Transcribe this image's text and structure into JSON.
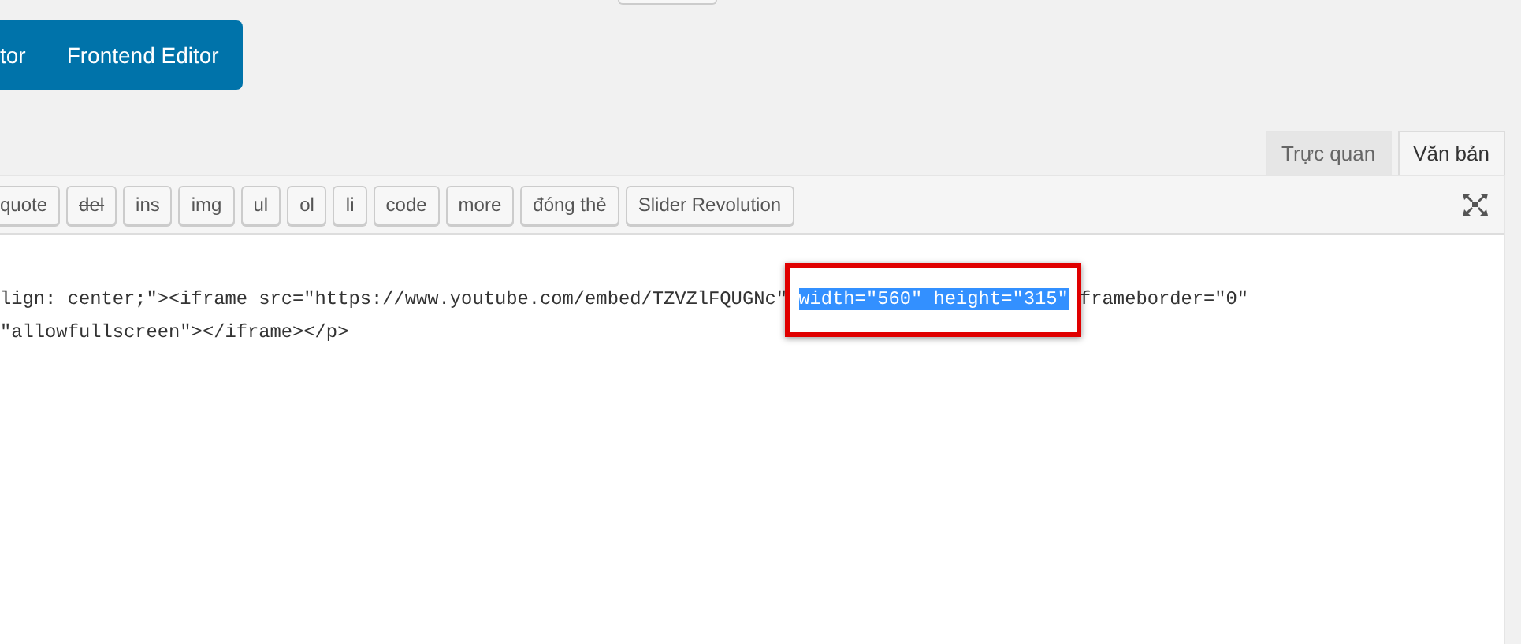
{
  "editor_switch": [
    "tor",
    "Frontend Editor"
  ],
  "tabs": [
    {
      "label": "Trực quan",
      "selected": false
    },
    {
      "label": "Văn bản",
      "selected": true
    }
  ],
  "toolbar": [
    {
      "label": "quote",
      "kind": "text"
    },
    {
      "label": "del",
      "kind": "strike"
    },
    {
      "label": "ins",
      "kind": "text"
    },
    {
      "label": "img",
      "kind": "text"
    },
    {
      "label": "ul",
      "kind": "text"
    },
    {
      "label": "ol",
      "kind": "text"
    },
    {
      "label": "li",
      "kind": "text"
    },
    {
      "label": "code",
      "kind": "text"
    },
    {
      "label": "more",
      "kind": "text"
    },
    {
      "label": "đóng thẻ",
      "kind": "text"
    },
    {
      "label": "Slider Revolution",
      "kind": "text"
    }
  ],
  "code_lines": [
    [
      {
        "text": "lign: center;\"><iframe src=\"https://www.youtube.com/embed/TZVZlFQUGNc\" ",
        "selected": false
      },
      {
        "text": "width=\"560\" height=\"315\"",
        "selected": true
      },
      {
        "text": " frameborder=\"0\"",
        "selected": false
      }
    ],
    [
      {
        "text": "\"allowfullscreen\"></iframe></p>",
        "selected": false
      }
    ]
  ]
}
